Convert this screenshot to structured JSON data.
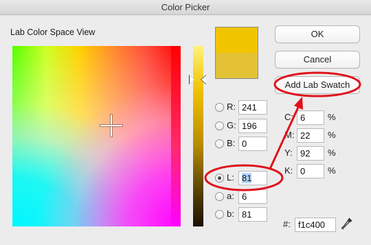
{
  "window": {
    "title": "Color Picker"
  },
  "section_label": "Lab Color Space View",
  "swatches": {
    "new_color": "#f1c400",
    "old_color": "#e3c236"
  },
  "buttons": {
    "ok": "OK",
    "cancel": "Cancel",
    "add_swatch": "Add Lab Swatch"
  },
  "rgb": {
    "r": {
      "label": "R:",
      "value": "241"
    },
    "g": {
      "label": "G:",
      "value": "196"
    },
    "b": {
      "label": "B:",
      "value": "0"
    }
  },
  "lab": {
    "l": {
      "label": "L:",
      "value": "81",
      "selected": true
    },
    "a": {
      "label": "a:",
      "value": "6"
    },
    "b": {
      "label": "b:",
      "value": "81"
    }
  },
  "cmyk": {
    "c": {
      "label": "C:",
      "value": "6",
      "unit": "%"
    },
    "m": {
      "label": "M:",
      "value": "22",
      "unit": "%"
    },
    "y": {
      "label": "Y:",
      "value": "92",
      "unit": "%"
    },
    "k": {
      "label": "K:",
      "value": "0",
      "unit": "%"
    }
  },
  "hex": {
    "label": "#:",
    "value": "f1c400"
  },
  "icons": {
    "eyedropper": "eyedropper-icon"
  },
  "annotation_color": "#e0121b"
}
